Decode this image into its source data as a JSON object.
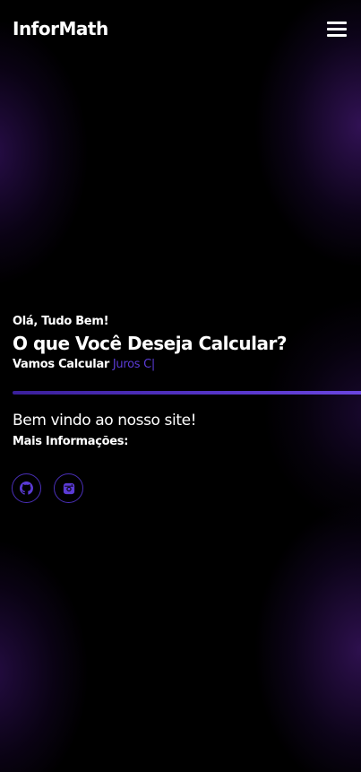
{
  "header": {
    "logo": "InforMath",
    "menu_icon": "hamburger-menu-icon"
  },
  "hero": {
    "greeting": "Olá, Tudo Bem!",
    "headline": "O que Você Deseja Calcular?",
    "calc_prefix": "Vamos Calcular",
    "calc_typed": "Juros C|"
  },
  "info": {
    "welcome": "Bem vindo ao nosso site!",
    "more_info": "Mais Informações:"
  },
  "socials": [
    {
      "icon": "github-icon"
    },
    {
      "icon": "instagram-icon"
    }
  ],
  "colors": {
    "background": "#000000",
    "accent": "#5b3bd6",
    "glow": "#3c1a6e"
  }
}
